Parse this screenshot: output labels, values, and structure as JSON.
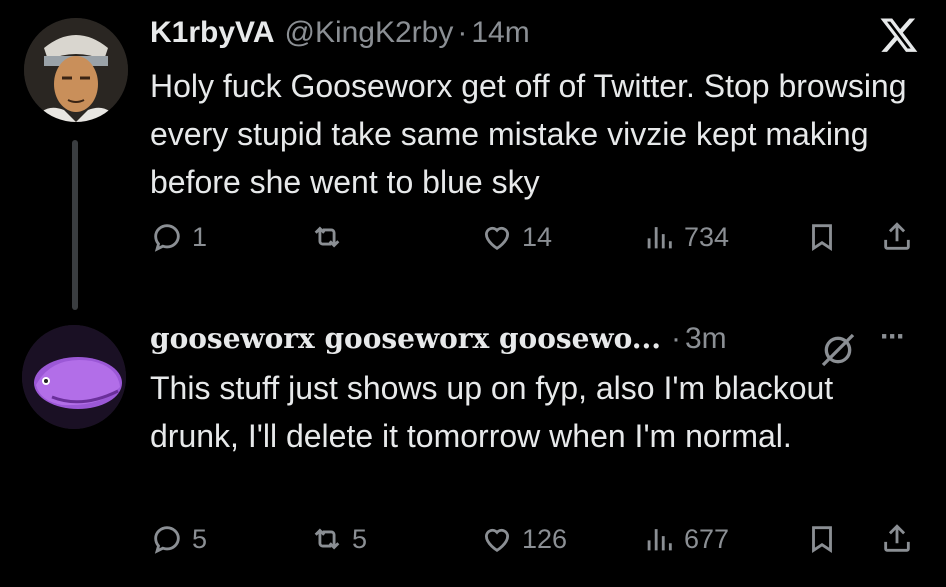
{
  "tweet1": {
    "display_name": "K1rbyVA",
    "handle": "@KingK2rby",
    "time": "14m",
    "text": "Holy fuck Gooseworx get off of Twitter. Stop browsing every stupid take same mistake vivzie kept making before she went to blue sky",
    "reply_count": "1",
    "retweet_count": "",
    "like_count": "14",
    "view_count": "734"
  },
  "tweet2": {
    "display_name": "gooseworx gooseworx goosewo...",
    "time": "3m",
    "text": "This stuff just shows up on fyp, also I'm blackout drunk, I'll delete it tomorrow when I'm normal.",
    "reply_count": "5",
    "retweet_count": "5",
    "like_count": "126",
    "view_count": "677"
  },
  "colors": {
    "background": "#000000",
    "text_primary": "#e7e9ea",
    "text_secondary": "#8b8f94",
    "thread_line": "#3a3d40"
  },
  "icons": [
    "x-logo-icon",
    "reply-icon",
    "retweet-icon",
    "like-icon",
    "views-icon",
    "bookmark-icon",
    "share-icon",
    "grok-icon",
    "more-icon"
  ]
}
